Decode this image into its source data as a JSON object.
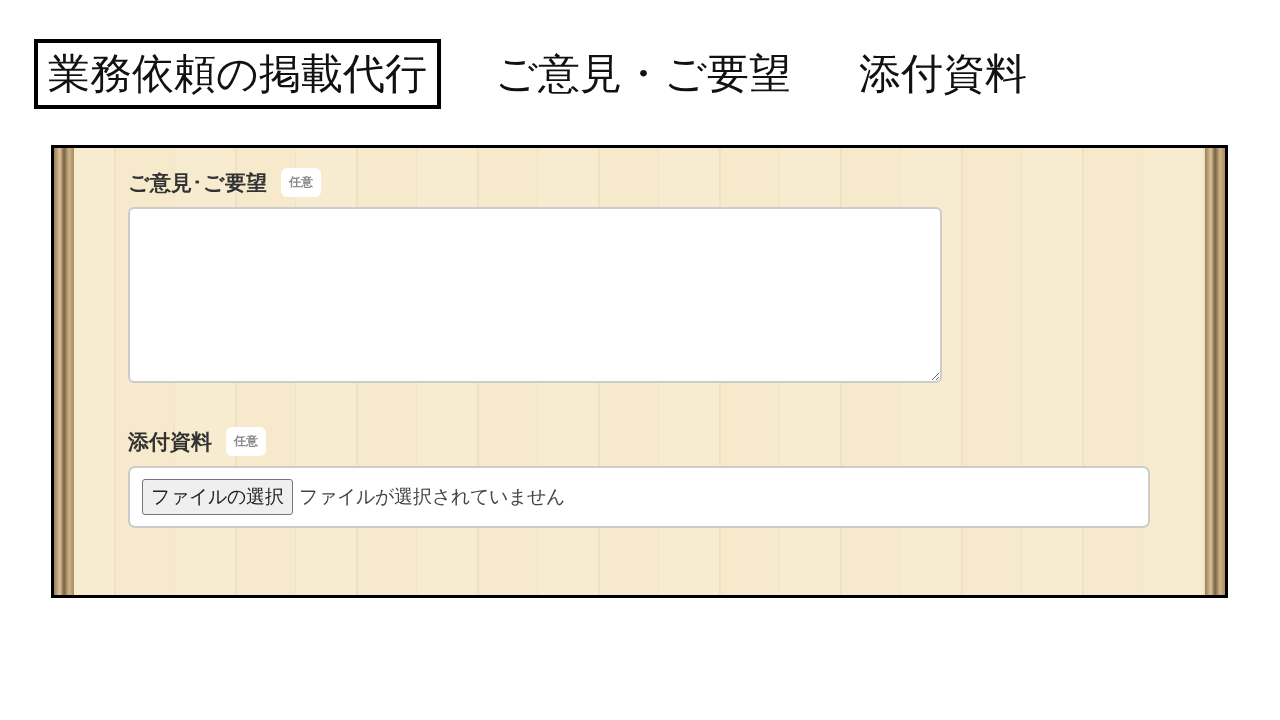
{
  "header": {
    "items": [
      {
        "label": "業務依頼の掲載代行",
        "selected": true
      },
      {
        "label": "ご意見・ご要望",
        "selected": false
      },
      {
        "label": "添付資料",
        "selected": false
      }
    ]
  },
  "form": {
    "fields": [
      {
        "kind": "textarea",
        "label": "ご意見･ご要望",
        "badge": "任意"
      },
      {
        "kind": "file",
        "label": "添付資料",
        "badge": "任意",
        "button": "ファイルの選択",
        "status": "ファイルが選択されていません"
      }
    ]
  }
}
